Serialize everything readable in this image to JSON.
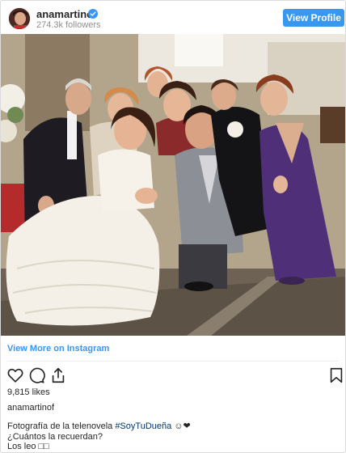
{
  "header": {
    "username": "anamartinof",
    "followers": "274.3k followers",
    "view_profile_label": "View Profile"
  },
  "post": {
    "view_more_label": "View More on Instagram",
    "likes": "9,815 likes",
    "caption_username": "anamartinof",
    "caption_prefix": "Fotografía de la telenovela ",
    "caption_hashtag": "#SoyTuDueña",
    "caption_emoji": " ☺❤",
    "caption_line2": "¿Cuántos la recuerdan?",
    "caption_line3": "Los leo □□"
  },
  "icons": [
    "verified-icon",
    "heart-icon",
    "comment-icon",
    "share-icon",
    "bookmark-icon"
  ],
  "colors": {
    "accent": "#3897f0",
    "hashtag": "#003569",
    "text": "#262626",
    "muted": "#8e8e8e"
  }
}
